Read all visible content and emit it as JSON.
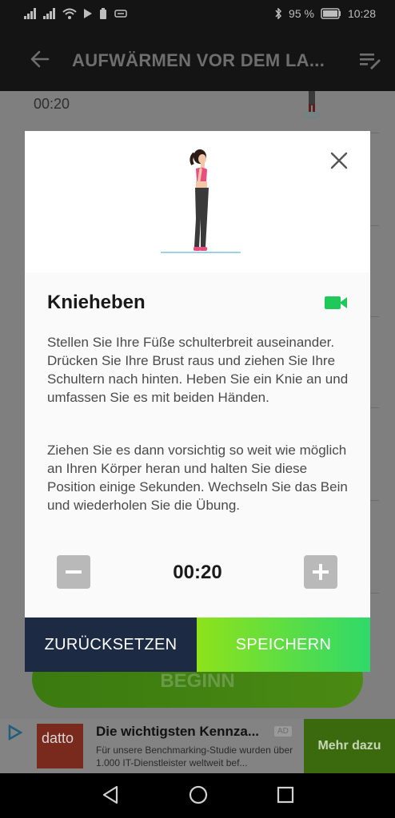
{
  "status_bar": {
    "battery": "95 %",
    "time": "10:28"
  },
  "toolbar": {
    "title": "AUFWÄRMEN VOR DEM LA..."
  },
  "background_list": {
    "first_time": "00:20",
    "begin_label": "BEGINN"
  },
  "modal": {
    "exercise_title": "Knieheben",
    "paragraph_1": "Stellen Sie Ihre Füße schulterbreit auseinander. Drücken Sie Ihre Brust raus und ziehen Sie Ihre Schultern nach hinten. Heben Sie ein Knie an und umfassen Sie es mit beiden Händen.",
    "paragraph_2": "Ziehen Sie es dann vorsichtig so weit wie möglich an Ihren Körper heran und halten Sie diese Position einige Sekunden. Wechseln Sie das Bein und wiederholen Sie die Übung.",
    "timer": "00:20",
    "reset_label": "ZURÜCKSETZEN",
    "save_label": "SPEICHERN",
    "accent_color": "#1ec95a"
  },
  "ad": {
    "logo_text": "datto",
    "headline": "Die wichtigsten Kennza...",
    "badge": "AD",
    "description": "Für unsere Benchmarking-Studie wurden über 1.000 IT-Dienstleister weltweit bef...",
    "cta": "Mehr dazu"
  }
}
